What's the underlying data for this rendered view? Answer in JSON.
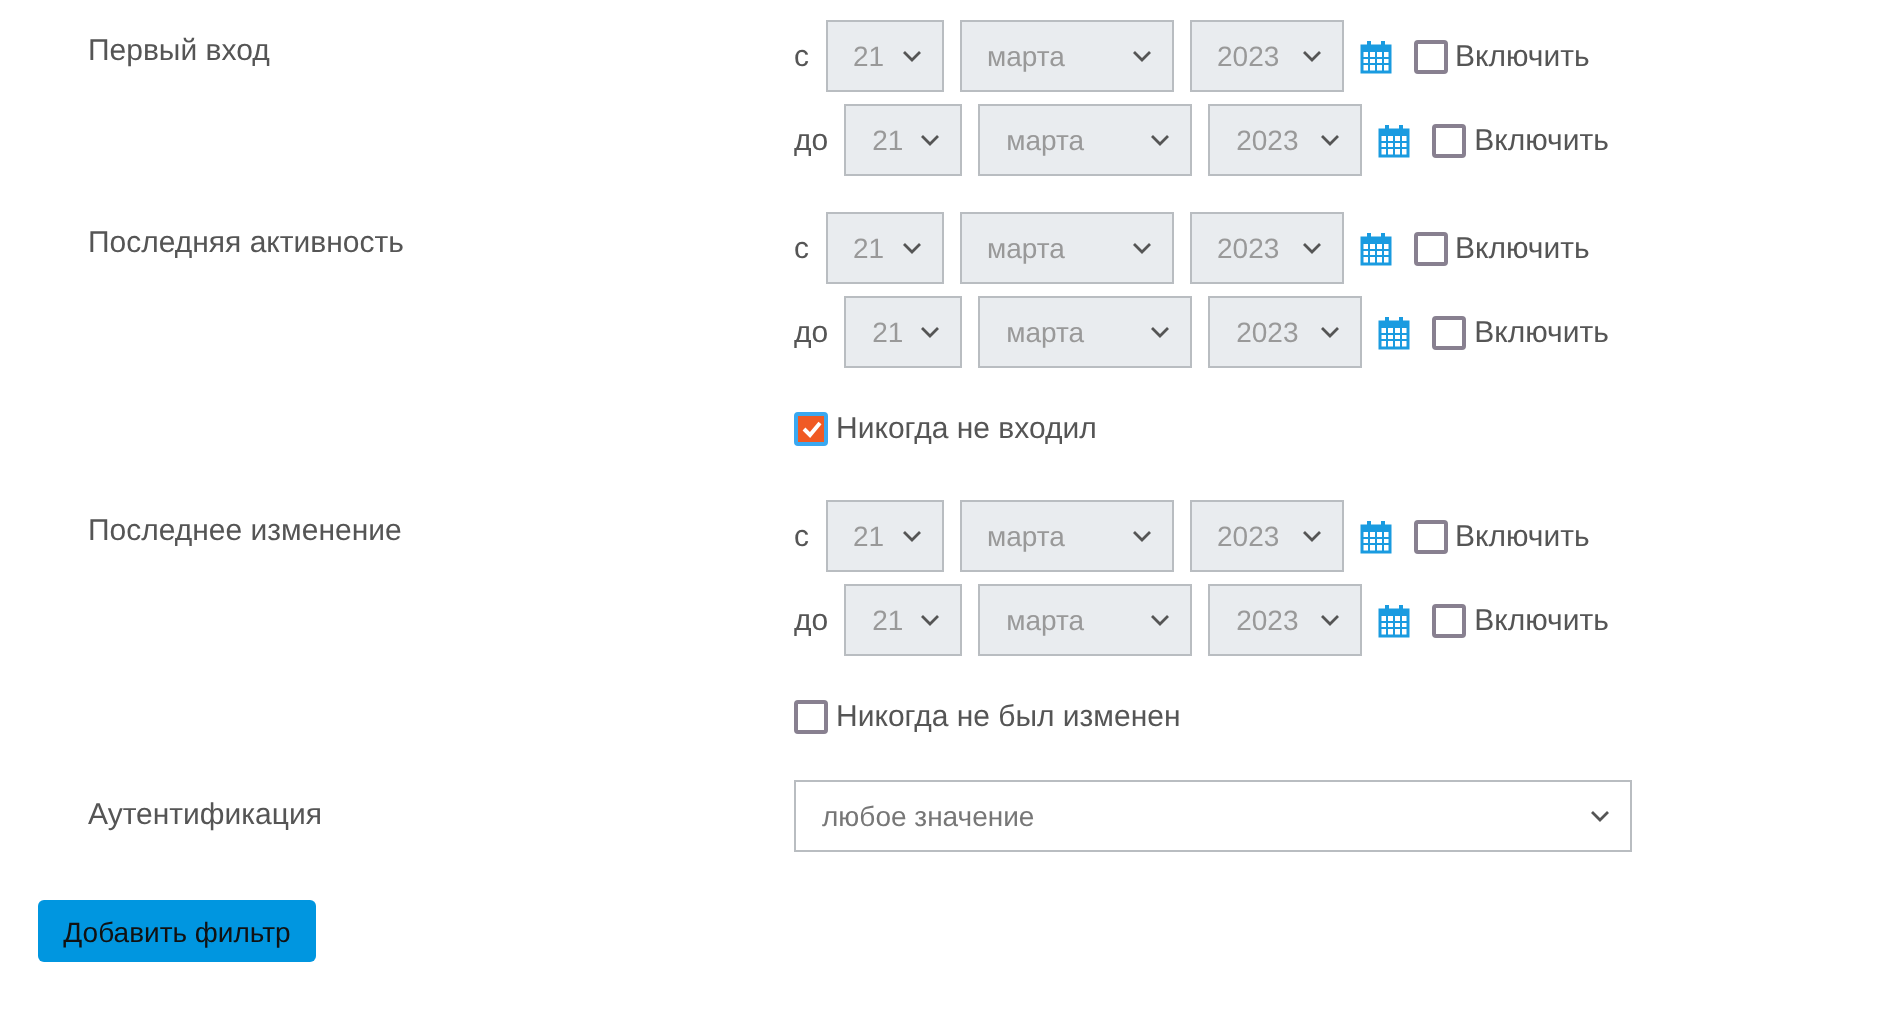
{
  "sections": [
    {
      "label": "Первый вход",
      "ranges": [
        {
          "prefix": "с",
          "day": "21",
          "month": "марта",
          "year": "2023",
          "include": {
            "label": "Включить",
            "checked": false
          }
        },
        {
          "prefix": "до",
          "day": "21",
          "month": "марта",
          "year": "2023",
          "include": {
            "label": "Включить",
            "checked": false
          }
        }
      ]
    },
    {
      "label": "Последняя активность",
      "ranges": [
        {
          "prefix": "с",
          "day": "21",
          "month": "марта",
          "year": "2023",
          "include": {
            "label": "Включить",
            "checked": false
          }
        },
        {
          "prefix": "до",
          "day": "21",
          "month": "марта",
          "year": "2023",
          "include": {
            "label": "Включить",
            "checked": false
          }
        }
      ],
      "option": {
        "label": "Никогда не входил",
        "checked": true
      }
    },
    {
      "label": "Последнее изменение",
      "ranges": [
        {
          "prefix": "с",
          "day": "21",
          "month": "марта",
          "year": "2023",
          "include": {
            "label": "Включить",
            "checked": false
          }
        },
        {
          "prefix": "до",
          "day": "21",
          "month": "марта",
          "year": "2023",
          "include": {
            "label": "Включить",
            "checked": false
          }
        }
      ],
      "option": {
        "label": "Никогда не был изменен",
        "checked": false
      }
    }
  ],
  "authentication": {
    "label": "Аутентификация",
    "value": "любое значение"
  },
  "add_button": "Добавить фильтр"
}
